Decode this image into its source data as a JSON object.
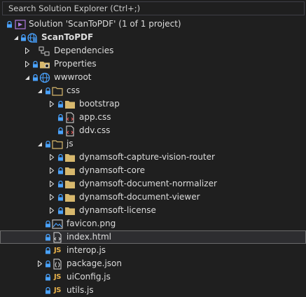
{
  "search": {
    "placeholder": "Search Solution Explorer (Ctrl+;)"
  },
  "tree": {
    "solution": "Solution 'ScanToPDF' (1 of 1 project)",
    "project": "ScanToPDF",
    "dependencies": "Dependencies",
    "properties": "Properties",
    "wwwroot": "wwwroot",
    "css": "css",
    "bootstrap": "bootstrap",
    "app_css": "app.css",
    "ddv_css": "ddv.css",
    "js": "js",
    "capture_vision_router": "dynamsoft-capture-vision-router",
    "core": "dynamsoft-core",
    "document_normalizer": "dynamsoft-document-normalizer",
    "document_viewer": "dynamsoft-document-viewer",
    "license": "dynamsoft-license",
    "favicon": "favicon.png",
    "index_html": "index.html",
    "interop_js": "interop.js",
    "package_json": "package.json",
    "uiconfig_js": "uiConfig.js",
    "utils_js": "utils.js"
  },
  "colors": {
    "background": "#1f1f1f",
    "text": "#dcdcdc",
    "lock": "#4aa3ff",
    "folder": "#d7b86d",
    "js": "#e6b04a",
    "selection": "#2d2d30",
    "globe": "#4aa3ff"
  }
}
